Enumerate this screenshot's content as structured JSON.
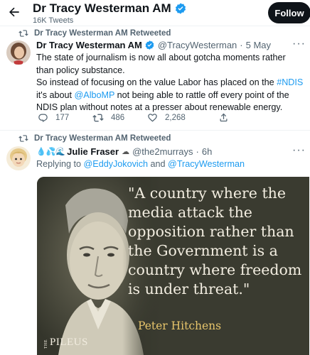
{
  "header": {
    "name": "Dr Tracy Westerman AM",
    "tweet_count": "16K Tweets",
    "follow_label": "Follow"
  },
  "tweet1": {
    "retweet_label": "Dr Tracy Westerman AM Retweeted",
    "author_name": "Dr Tracy Westerman AM",
    "handle": "@TracyWesterman",
    "dot": "·",
    "time": "5 May",
    "para1": "The state of journalism is now all about gotcha moments rather than policy substance.",
    "para2_a": "So instead of focusing on the value Labor has placed on the ",
    "para2_link1": "#NDIS",
    "para2_b": " it's about ",
    "para2_link2": "@AlboMP",
    "para2_c": " not being able to rattle off every point of the NDIS plan without notes at a presser about renewable energy.",
    "replies": "177",
    "retweets": "486",
    "likes": "2,268"
  },
  "tweet2": {
    "retweet_label": "Dr Tracy Westerman AM Retweeted",
    "emoji_prefix": "💧💦🌊",
    "author_name": "Julie Fraser",
    "emoji_suffix": "☁",
    "handle": "@the2murrays",
    "dot": "·",
    "time": "6h",
    "reply_prefix": "Replying to ",
    "reply_user1": "@EddyJokovich",
    "reply_and": " and ",
    "reply_user2": "@TracyWesterman",
    "media": {
      "quote": "\"A country where the media attack the opposition rather than the Government is a country where freedom is under threat.\"",
      "author": "Peter Hitchens",
      "brand_small": "THE",
      "brand": "PILEUS"
    }
  },
  "colors": {
    "accent": "#1d9bf0",
    "text": "#0f1419",
    "secondary": "#536471",
    "media_bg": "#3a3b30",
    "quote_author": "#e6c46b"
  }
}
